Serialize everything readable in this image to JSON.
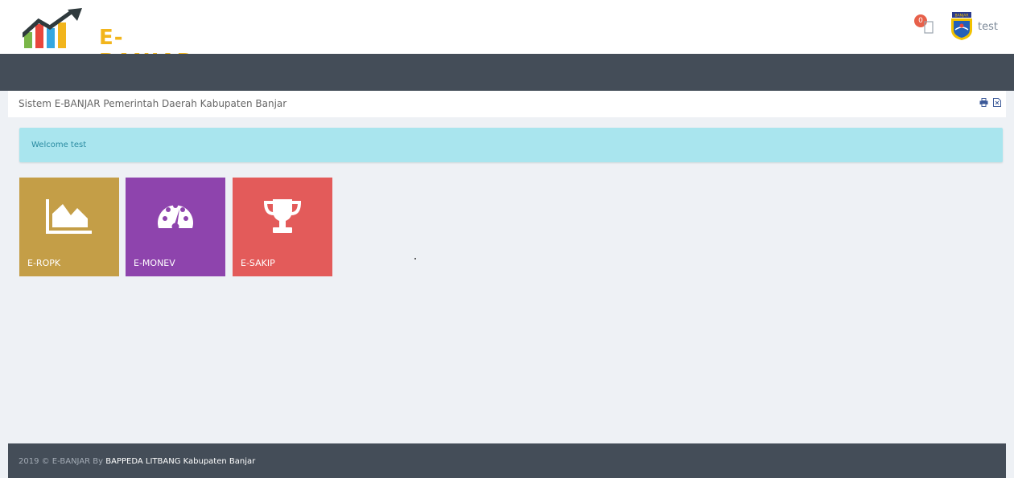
{
  "header": {
    "logo_text": "E-BANJAR",
    "notification_count": "0",
    "user_name": "test",
    "emblem_text": "BANJAR"
  },
  "page": {
    "title": "Sistem E-BANJAR Pemerintah Daerah Kabupaten Banjar",
    "tools": [
      "print-icon",
      "export-icon"
    ]
  },
  "alert": {
    "message": "Welcome test"
  },
  "tiles": [
    {
      "label": "E-ROPK",
      "icon": "area-chart-icon",
      "color": "#c49e47"
    },
    {
      "label": "E-MONEV",
      "icon": "dashboard-icon",
      "color": "#8e44ad"
    },
    {
      "label": "E-SAKIP",
      "icon": "trophy-icon",
      "color": "#e35b5a"
    }
  ],
  "footer": {
    "prefix": "2019 © E-BANJAR By ",
    "org": "BAPPEDA LITBANG Kabupaten Banjar"
  },
  "colors": {
    "navbar": "#444d58",
    "background": "#eef1f5",
    "alert": "#a9e5ee",
    "brand_yellow": "#f2b51c"
  }
}
